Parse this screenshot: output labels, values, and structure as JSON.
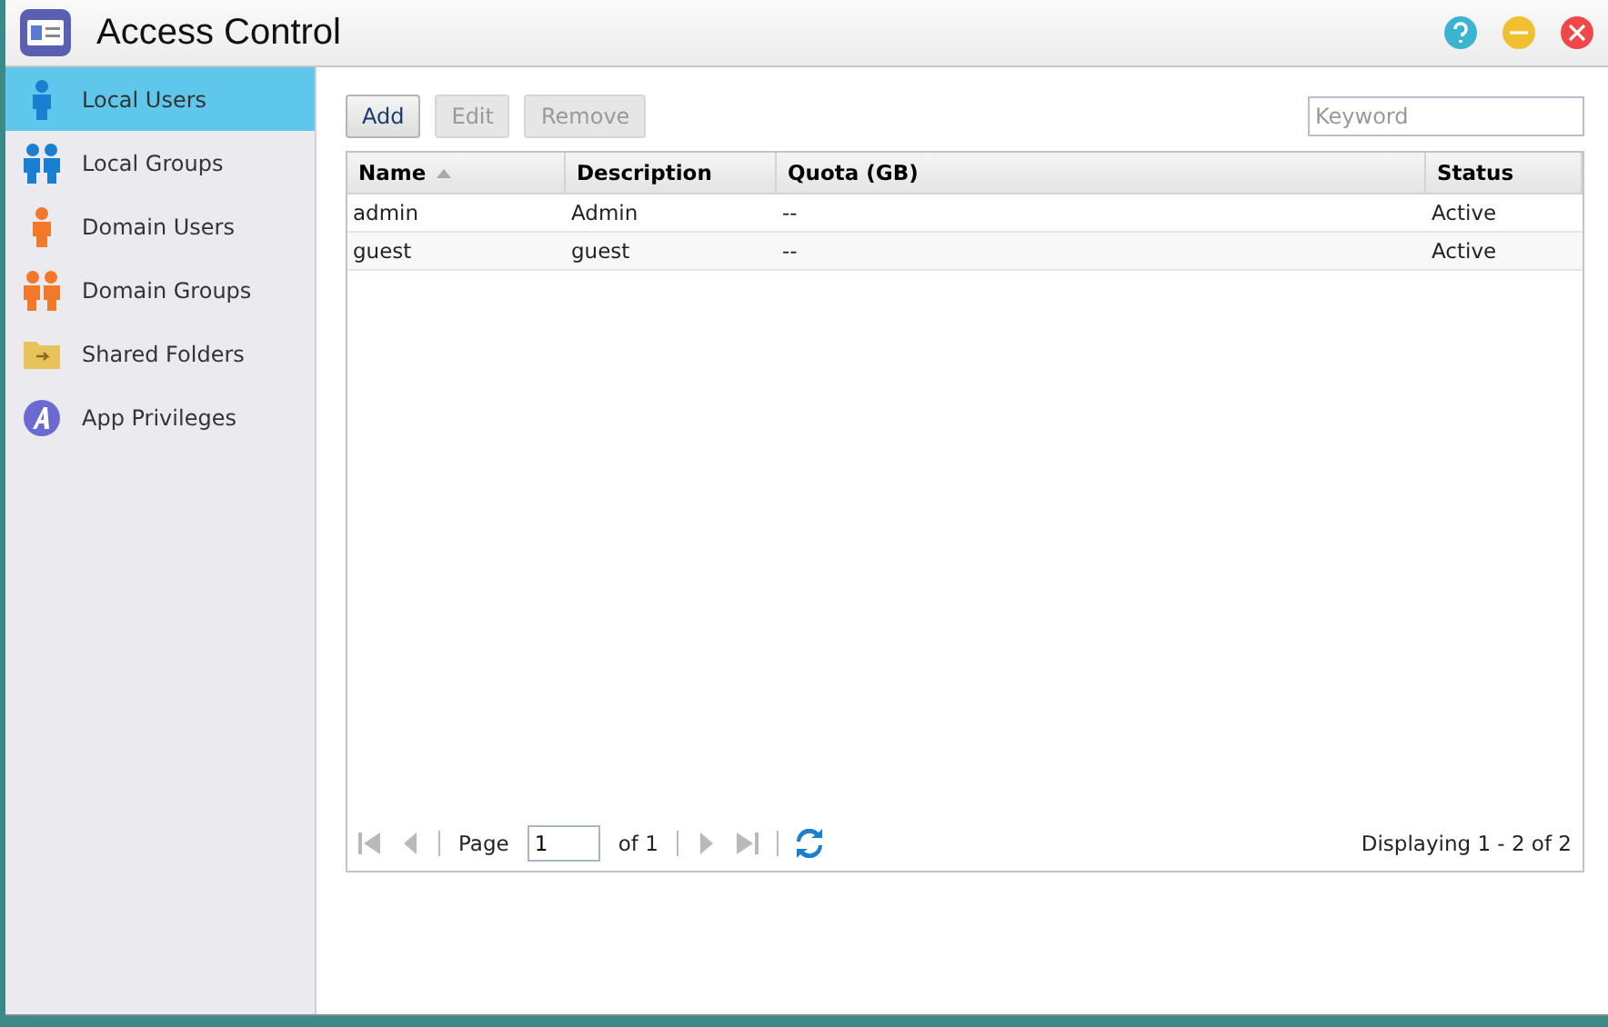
{
  "window": {
    "title": "Access Control"
  },
  "sidebar": {
    "items": [
      {
        "label": "Local Users",
        "kind": "user",
        "color": "#1a7fd0",
        "selected": true
      },
      {
        "label": "Local Groups",
        "kind": "group",
        "color": "#1a7fd0",
        "selected": false
      },
      {
        "label": "Domain Users",
        "kind": "user",
        "color": "#f07a2a",
        "selected": false
      },
      {
        "label": "Domain Groups",
        "kind": "group",
        "color": "#f07a2a",
        "selected": false
      },
      {
        "label": "Shared Folders",
        "kind": "folder",
        "color": "#e8c25a",
        "selected": false
      },
      {
        "label": "App Privileges",
        "kind": "app",
        "color": "#6a6ad0",
        "selected": false
      }
    ]
  },
  "toolbar": {
    "buttons": [
      {
        "label": "Add",
        "disabled": false
      },
      {
        "label": "Edit",
        "disabled": true
      },
      {
        "label": "Remove",
        "disabled": true
      }
    ],
    "search": {
      "placeholder": "Keyword"
    }
  },
  "table": {
    "columns": [
      {
        "label": "Name",
        "sorted": true
      },
      {
        "label": "Description",
        "sorted": false
      },
      {
        "label": "Quota (GB)",
        "sorted": false
      },
      {
        "label": "Status",
        "sorted": false
      }
    ],
    "rows": [
      [
        "admin",
        "Admin",
        "--",
        "Active"
      ],
      [
        "guest",
        "guest",
        "--",
        "Active"
      ]
    ]
  },
  "pager": {
    "page_label": "Page",
    "page": "1",
    "of": "of 1",
    "first_disabled": true,
    "prev_disabled": true,
    "next_disabled": true,
    "last_disabled": true,
    "summary": "Displaying 1 - 2 of 2"
  }
}
